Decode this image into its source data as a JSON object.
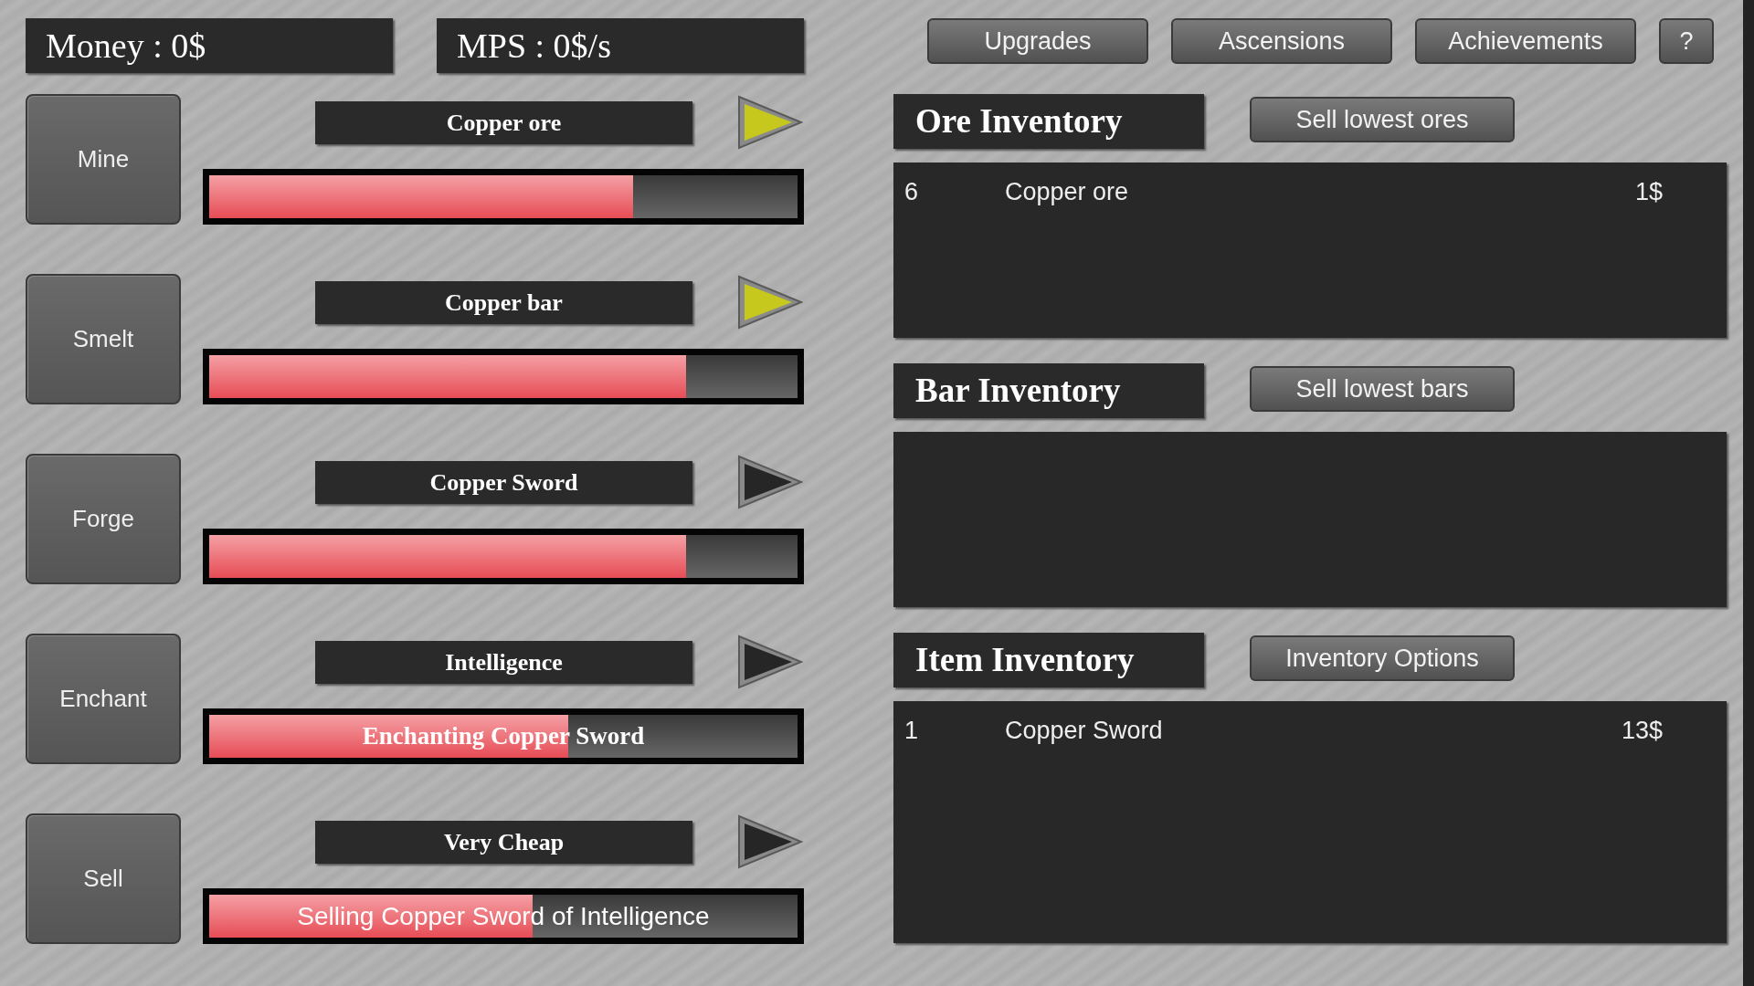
{
  "stats": {
    "money": "Money : 0$",
    "mps": "MPS : 0$/s"
  },
  "top_buttons": [
    {
      "label": "Upgrades"
    },
    {
      "label": "Ascensions"
    },
    {
      "label": "Achievements"
    },
    {
      "label": "?"
    }
  ],
  "stations": [
    {
      "action": "Mine",
      "target": "Copper ore",
      "arrow_active": true,
      "level": 0.72
    },
    {
      "action": "Smelt",
      "target": "Copper bar",
      "arrow_active": true,
      "level": 0.81
    },
    {
      "action": "Forge",
      "target": "Copper Sword",
      "arrow_active": false,
      "level": 0.81
    },
    {
      "action": "Enchant",
      "target": "Intelligence",
      "arrow_active": false,
      "level": 0.61,
      "progress_text": "Enchanting Copper Sword"
    },
    {
      "action": "Sell",
      "target": "Very Cheap",
      "arrow_active": false,
      "level": 0.55,
      "progress_text": "Selling Copper Sword of Intelligence"
    }
  ],
  "inventories": [
    {
      "title": "Ore Inventory",
      "button": "Sell lowest ores",
      "items": [
        {
          "quantity": "6",
          "name": "Copper ore",
          "price": "1$"
        }
      ]
    },
    {
      "title": "Bar Inventory",
      "button": "Sell lowest bars"
    },
    {
      "title": "Item Inventory",
      "button": "Inventory Options",
      "items": [
        {
          "quantity": "1",
          "name": "Copper Sword",
          "price": "13$"
        }
      ]
    }
  ]
}
